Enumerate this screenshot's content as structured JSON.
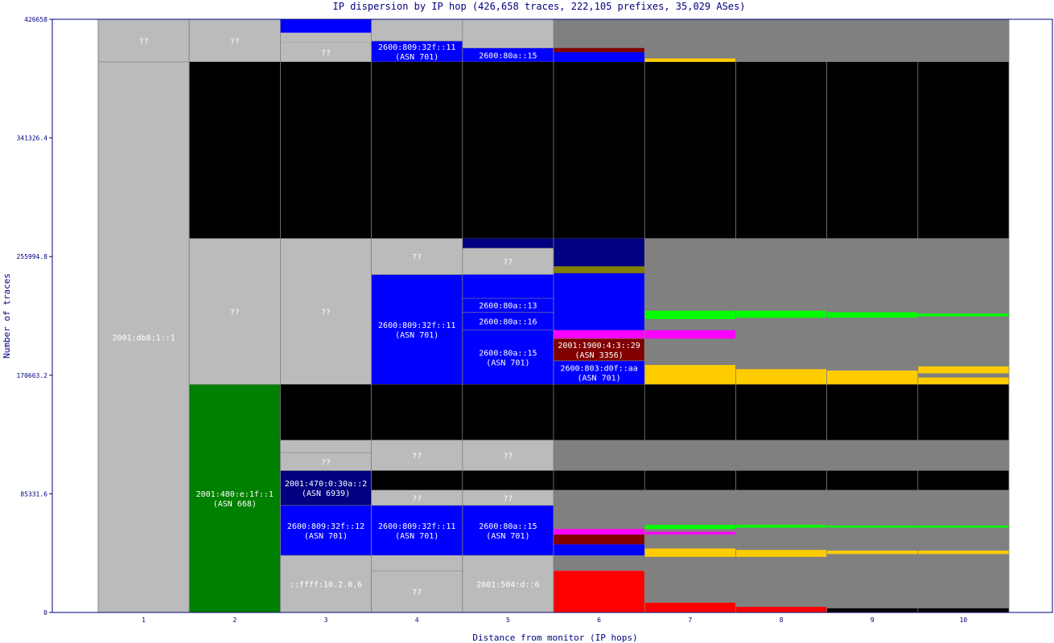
{
  "chart_data": {
    "type": "stacked-bar",
    "title": "IP dispersion by IP hop (426,658 traces, 222,105 prefixes, 35,029 ASes)",
    "xlabel": "Distance from monitor (IP hops)",
    "ylabel": "Number of traces",
    "ylim": [
      0,
      426658
    ],
    "y_ticks": [
      "0",
      "85331.6",
      "170663.2",
      "255994.8",
      "341326.4",
      "426658"
    ],
    "categories": [
      "1",
      "2",
      "3",
      "4",
      "5",
      "6",
      "7",
      "8",
      "9",
      "10"
    ],
    "grid": false,
    "colors": {
      "unknown": "#bbbbbb",
      "dark_gray": "#808080",
      "black": "#000000",
      "blue": "#0000ff",
      "navy": "#000080",
      "green": "#008000",
      "maroon": "#800000",
      "red": "#ff0000",
      "gold": "#ffcc00",
      "lime": "#00ff00",
      "magenta": "#ff00ff",
      "cyan": "#00ffff",
      "olive": "#808000",
      "axis": "#000080"
    },
    "columns": [
      {
        "hop": "1",
        "segments": [
          {
            "from": 396000,
            "to": 426658,
            "color": "#bbbbbb",
            "label": "??"
          },
          {
            "from": 0,
            "to": 396000,
            "color": "#bbbbbb",
            "label": "2001:db8:1::1"
          }
        ]
      },
      {
        "hop": "2",
        "segments": [
          {
            "from": 396000,
            "to": 426658,
            "color": "#bbbbbb",
            "label": "??"
          },
          {
            "from": 269000,
            "to": 396000,
            "color": "#000000"
          },
          {
            "from": 164000,
            "to": 269000,
            "color": "#bbbbbb",
            "label": "??"
          },
          {
            "from": 0,
            "to": 164000,
            "color": "#008000",
            "label": "2001:480:e:1f::1",
            "asn": "(ASN 668)"
          }
        ]
      },
      {
        "hop": "3",
        "segments": [
          {
            "from": 396000,
            "to": 410000,
            "color": "#bbbbbb",
            "label": "??"
          },
          {
            "from": 410000,
            "to": 417000,
            "color": "#bbbbbb"
          },
          {
            "from": 417000,
            "to": 426658,
            "color": "#0000ff"
          },
          {
            "from": 269000,
            "to": 396000,
            "color": "#000000"
          },
          {
            "from": 164000,
            "to": 269000,
            "color": "#bbbbbb",
            "label": "??"
          },
          {
            "from": 124000,
            "to": 164000,
            "color": "#000000"
          },
          {
            "from": 102000,
            "to": 124000,
            "color": "#bbbbbb"
          },
          {
            "from": 102000,
            "to": 115000,
            "color": "#bbbbbb",
            "label": "??"
          },
          {
            "from": 77000,
            "to": 102000,
            "color": "#000080",
            "label": "2001:470:0:30a::2",
            "asn": "(ASN 6939)"
          },
          {
            "from": 41000,
            "to": 77000,
            "color": "#0000ff",
            "label": "2600:809:32f::12",
            "asn": "(ASN 701)"
          },
          {
            "from": 0,
            "to": 41000,
            "color": "#bbbbbb",
            "label": "::ffff:10.2.0.6"
          }
        ]
      },
      {
        "hop": "4",
        "segments": [
          {
            "from": 411000,
            "to": 426658,
            "color": "#bbbbbb"
          },
          {
            "from": 396000,
            "to": 411000,
            "color": "#0000ff",
            "label": "2600:809:32f::11",
            "asn": "(ASN 701)"
          },
          {
            "from": 269000,
            "to": 396000,
            "color": "#000000"
          },
          {
            "from": 243000,
            "to": 269000,
            "color": "#bbbbbb",
            "label": "??"
          },
          {
            "from": 164000,
            "to": 243000,
            "color": "#0000ff",
            "label": "2600:809:32f::11",
            "asn": "(ASN 701)"
          },
          {
            "from": 124000,
            "to": 164000,
            "color": "#000000"
          },
          {
            "from": 102000,
            "to": 124000,
            "color": "#bbbbbb",
            "label": "??"
          },
          {
            "from": 88000,
            "to": 102000,
            "color": "#000000"
          },
          {
            "from": 77000,
            "to": 88000,
            "color": "#bbbbbb",
            "label": "??"
          },
          {
            "from": 41000,
            "to": 77000,
            "color": "#0000ff",
            "label": "2600:809:32f::11",
            "asn": "(ASN 701)"
          },
          {
            "from": 30000,
            "to": 41000,
            "color": "#bbbbbb"
          },
          {
            "from": 0,
            "to": 30000,
            "color": "#bbbbbb",
            "label": "??"
          }
        ]
      },
      {
        "hop": "5",
        "segments": [
          {
            "from": 406000,
            "to": 426658,
            "color": "#bbbbbb"
          },
          {
            "from": 396000,
            "to": 406000,
            "color": "#0000ff",
            "label": "2600:80a::15"
          },
          {
            "from": 269000,
            "to": 396000,
            "color": "#000000"
          },
          {
            "from": 262000,
            "to": 269000,
            "color": "#000080"
          },
          {
            "from": 243000,
            "to": 262000,
            "color": "#bbbbbb",
            "label": "??"
          },
          {
            "from": 226000,
            "to": 243000,
            "color": "#0000ff"
          },
          {
            "from": 216000,
            "to": 226000,
            "color": "#0000ff",
            "label": "2600:80a::13"
          },
          {
            "from": 203000,
            "to": 216000,
            "color": "#0000ff",
            "label": "2600:80a::16"
          },
          {
            "from": 164000,
            "to": 203000,
            "color": "#0000ff",
            "label": "2600:80a::15",
            "asn": "(ASN 701)"
          },
          {
            "from": 124000,
            "to": 164000,
            "color": "#000000"
          },
          {
            "from": 102000,
            "to": 124000,
            "color": "#bbbbbb",
            "label": "??"
          },
          {
            "from": 88000,
            "to": 102000,
            "color": "#000000"
          },
          {
            "from": 77000,
            "to": 88000,
            "color": "#bbbbbb",
            "label": "??"
          },
          {
            "from": 41000,
            "to": 77000,
            "color": "#0000ff",
            "label": "2600:80a::15",
            "asn": "(ASN 701)"
          },
          {
            "from": 0,
            "to": 41000,
            "color": "#bbbbbb",
            "label": "2001:504:d::6"
          }
        ]
      },
      {
        "hop": "6",
        "segments": [
          {
            "from": 396000,
            "to": 426658,
            "color": "#808080"
          },
          {
            "from": 396000,
            "to": 403000,
            "color": "#0000ff"
          },
          {
            "from": 403000,
            "to": 406000,
            "color": "#800000"
          },
          {
            "from": 269000,
            "to": 396000,
            "color": "#000000"
          },
          {
            "from": 244000,
            "to": 269000,
            "color": "#000080"
          },
          {
            "from": 244000,
            "to": 249000,
            "color": "#808000"
          },
          {
            "from": 203000,
            "to": 244000,
            "color": "#0000ff"
          },
          {
            "from": 197000,
            "to": 203000,
            "color": "#ff00ff"
          },
          {
            "from": 181000,
            "to": 197000,
            "color": "#800000",
            "label": "2001:1900:4:3::29",
            "asn": "(ASN 3356)"
          },
          {
            "from": 164000,
            "to": 181000,
            "color": "#0000ff",
            "label": "2600:803:d0f::aa",
            "asn": "(ASN 701)"
          },
          {
            "from": 124000,
            "to": 164000,
            "color": "#000000"
          },
          {
            "from": 102000,
            "to": 124000,
            "color": "#808080"
          },
          {
            "from": 88000,
            "to": 102000,
            "color": "#000000"
          },
          {
            "from": 41000,
            "to": 88000,
            "color": "#808080"
          },
          {
            "from": 41000,
            "to": 49000,
            "color": "#0000ff"
          },
          {
            "from": 49000,
            "to": 56000,
            "color": "#800000"
          },
          {
            "from": 56000,
            "to": 60000,
            "color": "#ff00ff"
          },
          {
            "from": 0,
            "to": 30000,
            "color": "#ff0000"
          },
          {
            "from": 30000,
            "to": 41000,
            "color": "#808080"
          }
        ]
      },
      {
        "hop": "7",
        "segments": [
          {
            "from": 396000,
            "to": 426658,
            "color": "#808080"
          },
          {
            "from": 396000,
            "to": 398500,
            "color": "#ffcc00"
          },
          {
            "from": 269000,
            "to": 396000,
            "color": "#000000"
          },
          {
            "from": 164000,
            "to": 269000,
            "color": "#808080"
          },
          {
            "from": 211000,
            "to": 217000,
            "color": "#00ff00"
          },
          {
            "from": 197000,
            "to": 203000,
            "color": "#ff00ff"
          },
          {
            "from": 164000,
            "to": 178000,
            "color": "#ffcc00"
          },
          {
            "from": 124000,
            "to": 164000,
            "color": "#000000"
          },
          {
            "from": 102000,
            "to": 124000,
            "color": "#808080"
          },
          {
            "from": 88000,
            "to": 102000,
            "color": "#000000"
          },
          {
            "from": 0,
            "to": 88000,
            "color": "#808080"
          },
          {
            "from": 60000,
            "to": 63000,
            "color": "#00ff00"
          },
          {
            "from": 56000,
            "to": 58000,
            "color": "#ff00ff"
          },
          {
            "from": 40000,
            "to": 46000,
            "color": "#ffcc00"
          },
          {
            "from": 0,
            "to": 7000,
            "color": "#ff0000"
          }
        ]
      },
      {
        "hop": "8",
        "segments": [
          {
            "from": 396000,
            "to": 426658,
            "color": "#808080"
          },
          {
            "from": 269000,
            "to": 396000,
            "color": "#000000"
          },
          {
            "from": 164000,
            "to": 269000,
            "color": "#808080"
          },
          {
            "from": 212000,
            "to": 217000,
            "color": "#00ff00"
          },
          {
            "from": 164000,
            "to": 175000,
            "color": "#ffcc00"
          },
          {
            "from": 124000,
            "to": 164000,
            "color": "#000000"
          },
          {
            "from": 102000,
            "to": 124000,
            "color": "#808080"
          },
          {
            "from": 88000,
            "to": 102000,
            "color": "#000000"
          },
          {
            "from": 0,
            "to": 88000,
            "color": "#808080"
          },
          {
            "from": 61000,
            "to": 63000,
            "color": "#00ff00"
          },
          {
            "from": 40000,
            "to": 45000,
            "color": "#ffcc00"
          },
          {
            "from": 0,
            "to": 4000,
            "color": "#ff0000"
          }
        ]
      },
      {
        "hop": "9",
        "segments": [
          {
            "from": 396000,
            "to": 426658,
            "color": "#808080"
          },
          {
            "from": 269000,
            "to": 396000,
            "color": "#000000"
          },
          {
            "from": 164000,
            "to": 269000,
            "color": "#808080"
          },
          {
            "from": 212000,
            "to": 216000,
            "color": "#00ff00"
          },
          {
            "from": 164000,
            "to": 174000,
            "color": "#ffcc00"
          },
          {
            "from": 124000,
            "to": 164000,
            "color": "#000000"
          },
          {
            "from": 102000,
            "to": 124000,
            "color": "#808080"
          },
          {
            "from": 88000,
            "to": 102000,
            "color": "#000000"
          },
          {
            "from": 0,
            "to": 88000,
            "color": "#808080"
          },
          {
            "from": 61000,
            "to": 62500,
            "color": "#00ff00"
          },
          {
            "from": 42000,
            "to": 44500,
            "color": "#ffcc00"
          },
          {
            "from": 0,
            "to": 3000,
            "color": "#000000"
          }
        ]
      },
      {
        "hop": "10",
        "segments": [
          {
            "from": 396000,
            "to": 426658,
            "color": "#808080"
          },
          {
            "from": 269000,
            "to": 396000,
            "color": "#000000"
          },
          {
            "from": 164000,
            "to": 269000,
            "color": "#808080"
          },
          {
            "from": 213000,
            "to": 215000,
            "color": "#00ff00"
          },
          {
            "from": 164000,
            "to": 169000,
            "color": "#ffcc00"
          },
          {
            "from": 172000,
            "to": 177000,
            "color": "#ffcc00"
          },
          {
            "from": 124000,
            "to": 164000,
            "color": "#000000"
          },
          {
            "from": 102000,
            "to": 124000,
            "color": "#808080"
          },
          {
            "from": 88000,
            "to": 102000,
            "color": "#000000"
          },
          {
            "from": 0,
            "to": 88000,
            "color": "#808080"
          },
          {
            "from": 61000,
            "to": 62500,
            "color": "#00ff00"
          },
          {
            "from": 42000,
            "to": 44500,
            "color": "#ffcc00"
          },
          {
            "from": 0,
            "to": 3000,
            "color": "#000000"
          }
        ]
      }
    ]
  }
}
